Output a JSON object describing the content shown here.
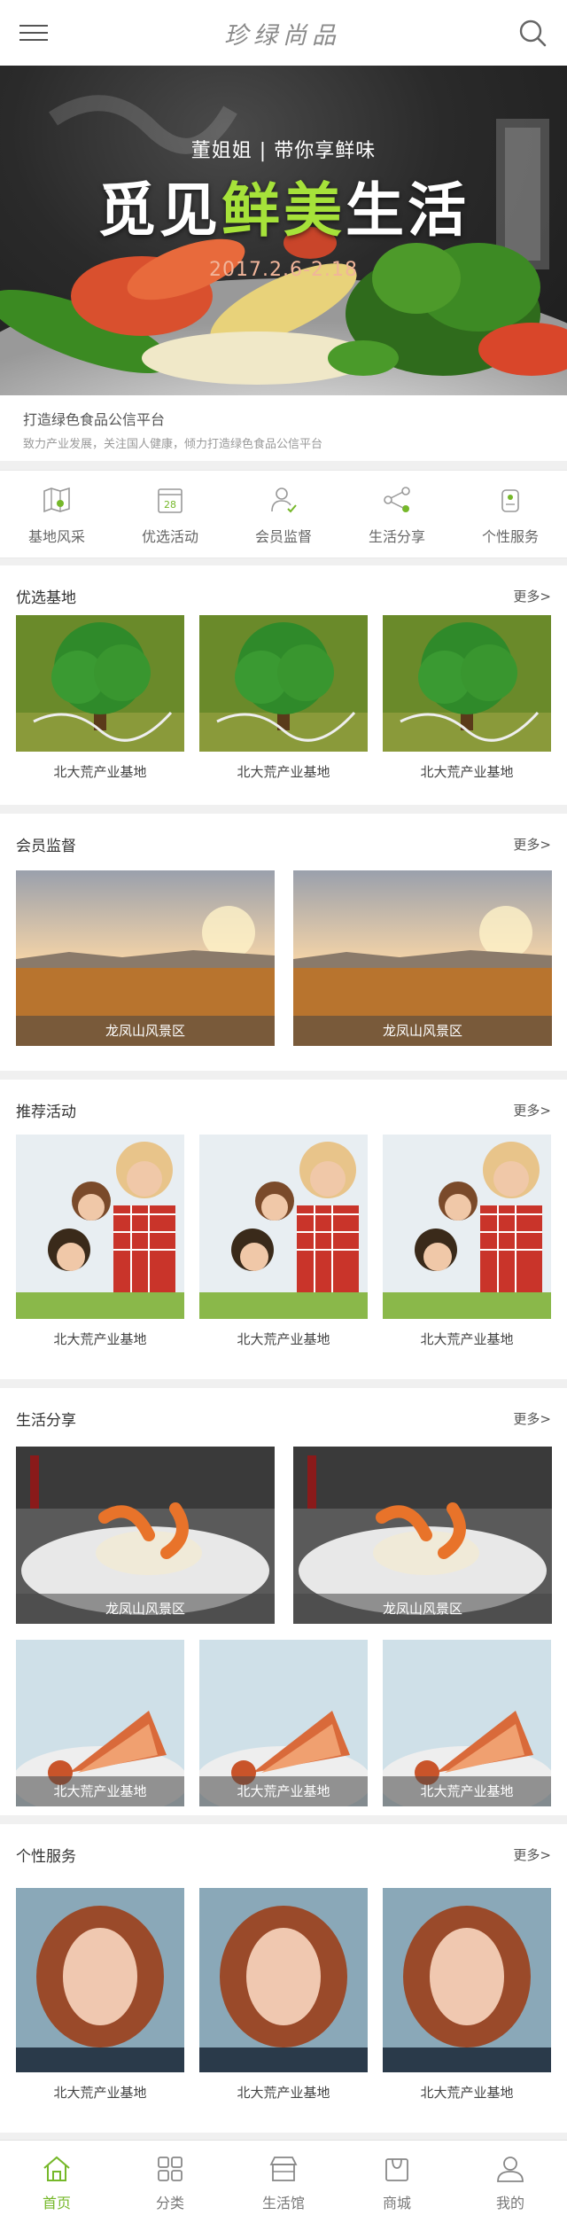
{
  "header": {
    "logo": "珍绿尚品",
    "menu_icon": "menu-icon",
    "search_icon": "search-icon"
  },
  "banner": {
    "subtitle": "董姐姐 | 带你享鲜味",
    "title_part1": "觅见",
    "title_highlight": "鲜美",
    "title_part2": "生活",
    "date": "2017.2.6-2.18",
    "highlight_color": "#a6e23a"
  },
  "slogan": {
    "main": "打造绿色食品公信平台",
    "desc": "致力产业发展，关注国人健康，倾力打造绿色食品公信平台"
  },
  "nav": [
    {
      "label": "基地风采",
      "icon": "map-icon"
    },
    {
      "label": "优选活动",
      "icon": "calendar-icon"
    },
    {
      "label": "会员监督",
      "icon": "member-icon"
    },
    {
      "label": "生活分享",
      "icon": "share-icon"
    },
    {
      "label": "个性服务",
      "icon": "service-icon"
    }
  ],
  "more_label": "更多>",
  "sections": {
    "bases": {
      "title": "优选基地",
      "items": [
        "北大荒产业基地",
        "北大荒产业基地",
        "北大荒产业基地"
      ]
    },
    "members": {
      "title": "会员监督",
      "items": [
        "龙凤山风景区",
        "龙凤山风景区"
      ]
    },
    "activities": {
      "title": "推荐活动",
      "items": [
        "北大荒产业基地",
        "北大荒产业基地",
        "北大荒产业基地"
      ]
    },
    "life": {
      "title": "生活分享",
      "big": [
        "龙凤山风景区",
        "龙凤山风景区"
      ],
      "small": [
        "北大荒产业基地",
        "北大荒产业基地",
        "北大荒产业基地"
      ]
    },
    "service": {
      "title": "个性服务",
      "items": [
        "北大荒产业基地",
        "北大荒产业基地",
        "北大荒产业基地"
      ]
    }
  },
  "tabbar": [
    {
      "label": "首页",
      "icon": "home-icon",
      "active": true
    },
    {
      "label": "分类",
      "icon": "category-icon"
    },
    {
      "label": "生活馆",
      "icon": "store-icon"
    },
    {
      "label": "商城",
      "icon": "bag-icon"
    },
    {
      "label": "我的",
      "icon": "user-icon"
    }
  ],
  "colors": {
    "accent": "#76b82a"
  }
}
